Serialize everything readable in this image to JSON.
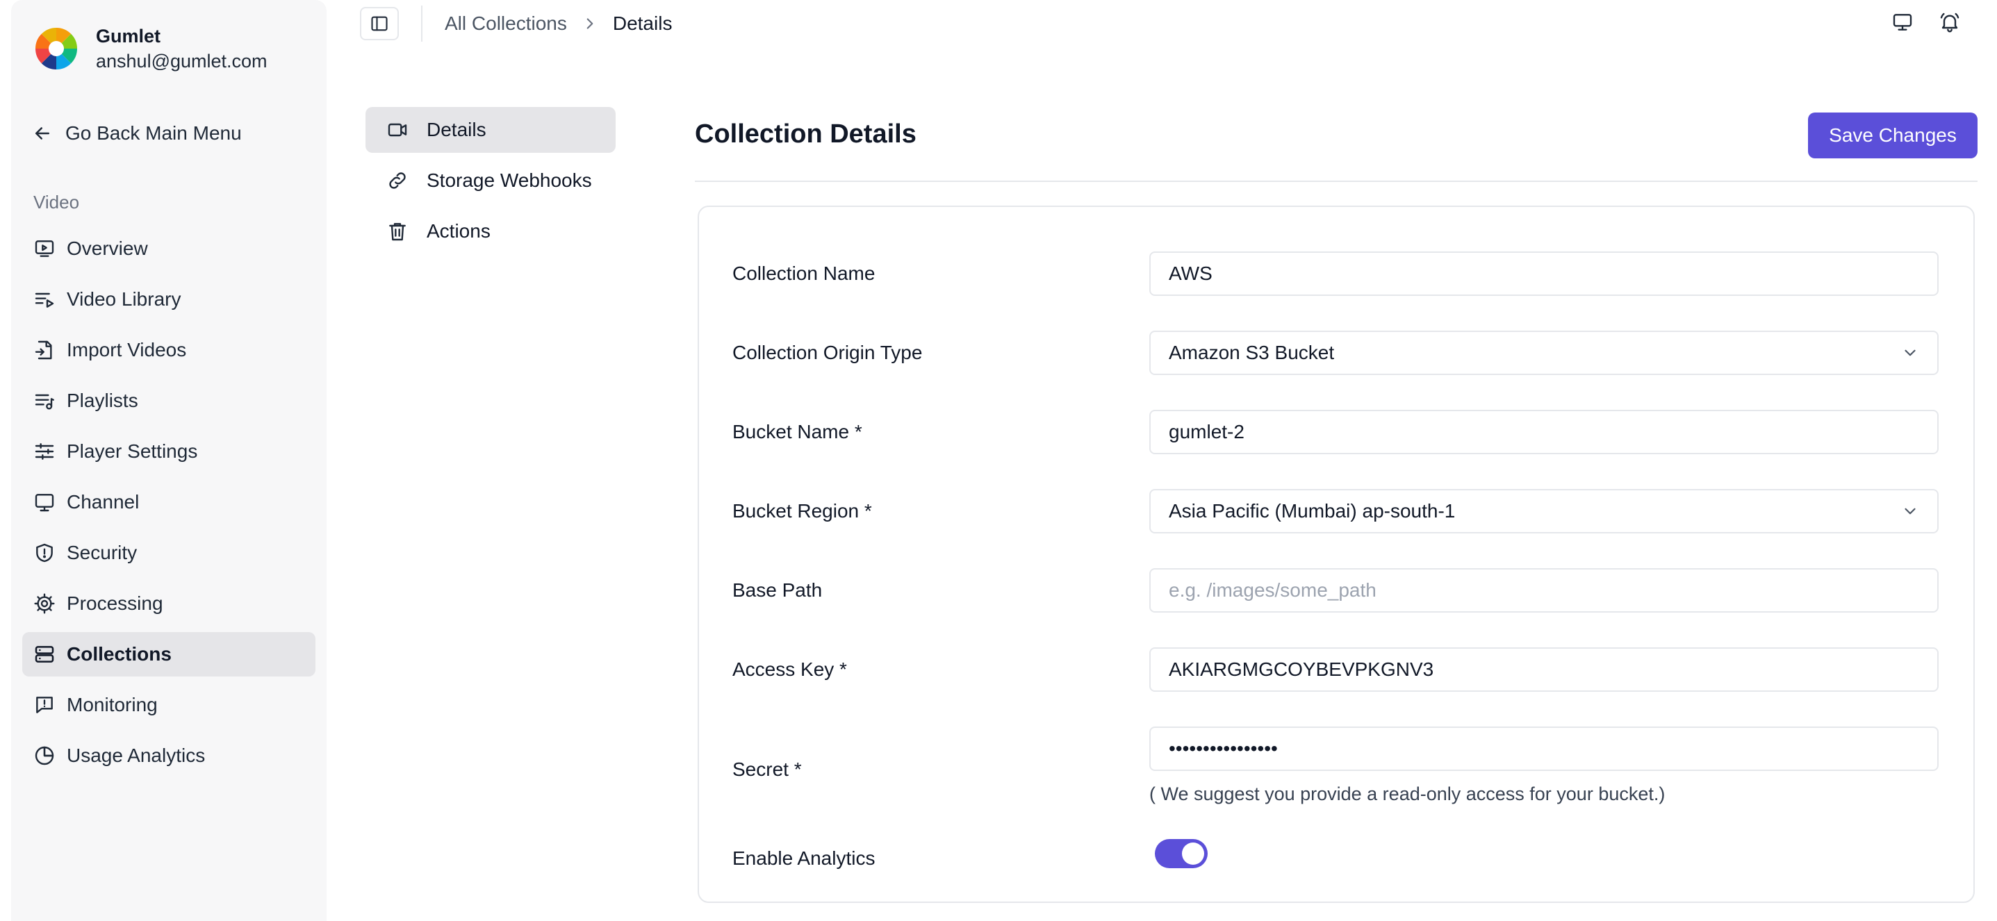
{
  "profile": {
    "org_name": "Gumlet",
    "email": "anshul@gumlet.com",
    "logo_icon": "gumlet-logo"
  },
  "sidebar": {
    "back_label": "Go Back Main Menu",
    "section_label": "Video",
    "items": [
      {
        "label": "Overview",
        "icon": "play-screen-icon",
        "active": false
      },
      {
        "label": "Video Library",
        "icon": "list-play-icon",
        "active": false
      },
      {
        "label": "Import Videos",
        "icon": "file-import-icon",
        "active": false
      },
      {
        "label": "Playlists",
        "icon": "playlist-icon",
        "active": false
      },
      {
        "label": "Player Settings",
        "icon": "sliders-icon",
        "active": false
      },
      {
        "label": "Channel",
        "icon": "monitor-icon",
        "active": false
      },
      {
        "label": "Security",
        "icon": "shield-icon",
        "active": false
      },
      {
        "label": "Processing",
        "icon": "gear-icon",
        "active": false
      },
      {
        "label": "Collections",
        "icon": "server-icon",
        "active": true
      },
      {
        "label": "Monitoring",
        "icon": "message-alert-icon",
        "active": false
      },
      {
        "label": "Usage Analytics",
        "icon": "pie-chart-icon",
        "active": false
      }
    ]
  },
  "breadcrumb": {
    "parent": "All Collections",
    "current": "Details"
  },
  "subnav": {
    "items": [
      {
        "label": "Details",
        "icon": "video-camera-icon",
        "active": true
      },
      {
        "label": "Storage Webhooks",
        "icon": "link-icon",
        "active": false
      },
      {
        "label": "Actions",
        "icon": "trash-icon",
        "active": false
      }
    ]
  },
  "main": {
    "title": "Collection Details",
    "save_label": "Save Changes",
    "hint": "( We suggest you provide a read-only access for your bucket.)",
    "fields": {
      "collection_name": {
        "label": "Collection Name",
        "value": "AWS"
      },
      "origin_type": {
        "label": "Collection Origin Type",
        "value": "Amazon S3 Bucket"
      },
      "bucket_name": {
        "label": "Bucket Name *",
        "value": "gumlet-2"
      },
      "bucket_region": {
        "label": "Bucket Region *",
        "value": "Asia Pacific (Mumbai) ap-south-1"
      },
      "base_path": {
        "label": "Base Path",
        "value": "",
        "placeholder": "e.g. /images/some_path"
      },
      "access_key": {
        "label": "Access Key *",
        "value": "AKIARGMGCOYBEVPKGNV3"
      },
      "secret": {
        "label": "Secret *",
        "value": "••••••••••••••••"
      },
      "enable_analytics": {
        "label": "Enable Analytics",
        "value": "on"
      }
    }
  },
  "colors": {
    "accent": "#5b4fd9",
    "sidebar_bg": "#f7f7f8",
    "active_bg": "#e5e5e8",
    "border": "#e5e7eb"
  }
}
